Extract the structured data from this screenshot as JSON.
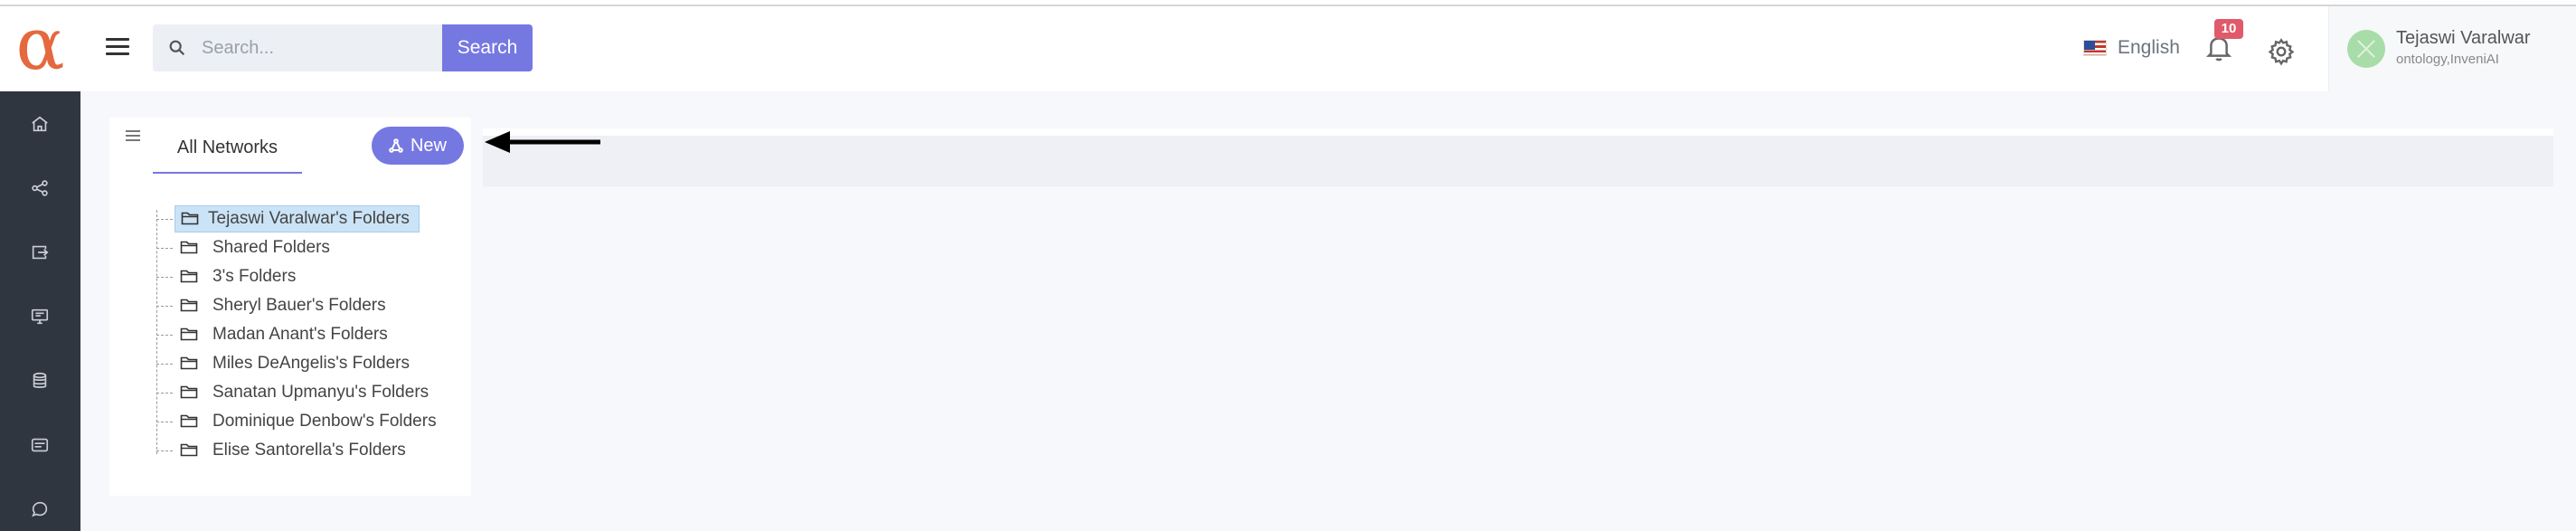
{
  "app": {
    "logo_glyph": "α",
    "logo_color": "#e5683e"
  },
  "sidebar": {
    "icons": [
      "home-icon",
      "share-icon",
      "export-icon",
      "monitor-icon",
      "database-icon",
      "message-card-icon",
      "chat-icon"
    ]
  },
  "header": {
    "search": {
      "placeholder": "Search...",
      "value": "",
      "button_label": "Search"
    },
    "language": {
      "label": "English",
      "flag": "us-flag-icon"
    },
    "notifications": {
      "count": "10"
    },
    "user": {
      "name": "Tejaswi Varalwar",
      "org": "ontology,InveniAI"
    },
    "accent_color": "#7678e2"
  },
  "panel": {
    "tab_label": "All Networks",
    "new_button_label": "New",
    "folders": [
      {
        "label": "Tejaswi Varalwar's Folders",
        "selected": true
      },
      {
        "label": "Shared Folders",
        "selected": false
      },
      {
        "label": "3's Folders",
        "selected": false
      },
      {
        "label": "Sheryl Bauer's Folders",
        "selected": false
      },
      {
        "label": "Madan Anant's Folders",
        "selected": false
      },
      {
        "label": "Miles DeAngelis's Folders",
        "selected": false
      },
      {
        "label": "Sanatan Upmanyu's Folders",
        "selected": false
      },
      {
        "label": "Dominique Denbow's Folders",
        "selected": false
      },
      {
        "label": "Elise Santorella's Folders",
        "selected": false
      }
    ]
  }
}
